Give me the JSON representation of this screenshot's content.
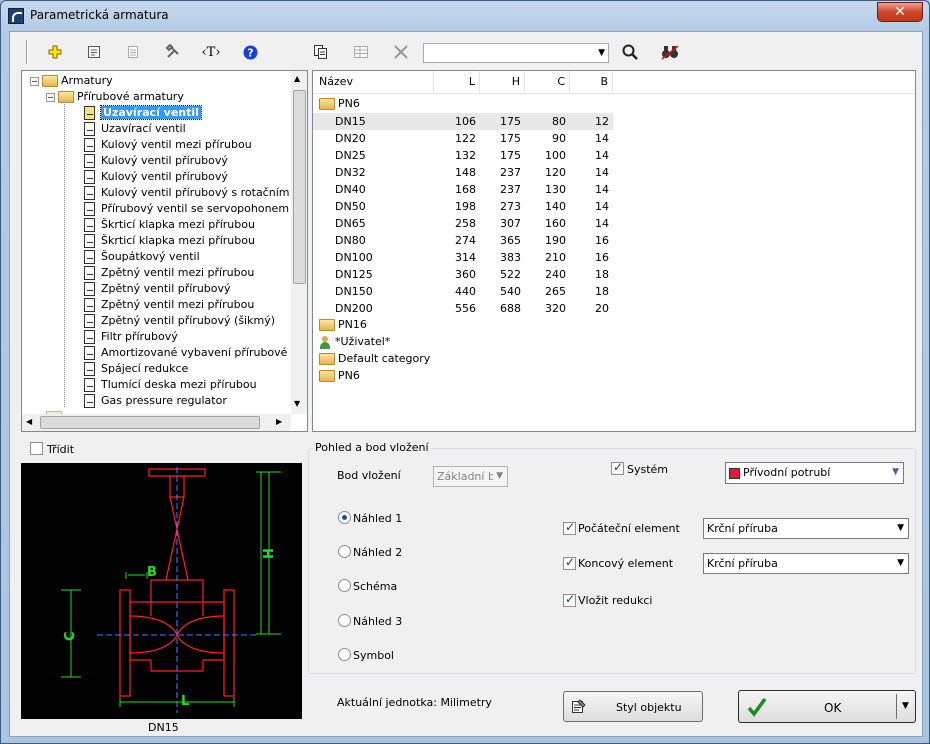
{
  "window": {
    "title": "Parametrická armatura"
  },
  "toolbar": {
    "icons": [
      "add-icon",
      "properties-icon",
      "list-icon",
      "tools-icon",
      "text-icon",
      "help-icon",
      "copy-icon",
      "table-icon",
      "delete-icon",
      "search-icon",
      "binoculars-icon"
    ],
    "search_value": ""
  },
  "tree": {
    "root": "Armatury",
    "group": "Přírubové armatury",
    "items": [
      "Uzavírací ventil",
      "Uzavírací ventil",
      "Kulový ventil mezi přírubou",
      "Kulový ventil přírubový",
      "Kulový ventil přírubový",
      "Kulový ventil přírubový s rotačním píste",
      "Přírubový ventil se servopohonem",
      "Škrticí klapka mezi přírubou",
      "Škrticí klapka mezi přírubou",
      "Šoupátkový ventil",
      "Zpětný ventil mezi přírubou",
      "Zpětný ventil přírubový",
      "Zpětný ventil mezi přírubou",
      "Zpětný ventil přírubový (šikmý)",
      "Filtr přírubový",
      "Amortizované vybavení přírubové",
      "Spájecí redukce",
      "Tlumící deska mezi přírubou",
      "Gas pressure regulator"
    ],
    "selected_index": 0
  },
  "table": {
    "columns": [
      "Název",
      "L",
      "H",
      "C",
      "B"
    ],
    "group1": "PN6",
    "rows": [
      [
        "DN15",
        "106",
        "175",
        "80",
        "12"
      ],
      [
        "DN20",
        "122",
        "175",
        "90",
        "14"
      ],
      [
        "DN25",
        "132",
        "175",
        "100",
        "14"
      ],
      [
        "DN32",
        "148",
        "237",
        "120",
        "14"
      ],
      [
        "DN40",
        "168",
        "237",
        "130",
        "14"
      ],
      [
        "DN50",
        "198",
        "273",
        "140",
        "14"
      ],
      [
        "DN65",
        "258",
        "307",
        "160",
        "14"
      ],
      [
        "DN80",
        "274",
        "365",
        "190",
        "16"
      ],
      [
        "DN100",
        "314",
        "383",
        "210",
        "16"
      ],
      [
        "DN125",
        "360",
        "522",
        "240",
        "18"
      ],
      [
        "DN150",
        "440",
        "540",
        "265",
        "18"
      ],
      [
        "DN200",
        "556",
        "688",
        "320",
        "20"
      ]
    ],
    "groups_after": [
      "PN16",
      "*Uživatel*",
      "Default category",
      "PN6"
    ]
  },
  "sort": {
    "label": "Třídit",
    "checked": false
  },
  "preview": {
    "caption": "DN15",
    "dims": {
      "B": "B",
      "H": "H",
      "C": "C",
      "L": "L"
    }
  },
  "view": {
    "title": "Pohled a bod vložení",
    "insert_point_label": "Bod vložení",
    "insert_point_value": "Základní bod",
    "radios": [
      "Náhled 1",
      "Náhled 2",
      "Schéma",
      "Náhled 3",
      "Symbol"
    ],
    "radio_selected": 0,
    "system_label": "Systém",
    "system_value": "Přívodní potrubí",
    "system_color": "#e0193a",
    "start_label": "Počáteční element",
    "start_value": "Krční příruba",
    "end_label": "Koncový element",
    "end_value": "Krční příruba",
    "reduce_label": "Vložit redukci"
  },
  "footer": {
    "units": "Aktuální jednotka: Milimetry",
    "style_button": "Styl objektu",
    "ok_button": "OK"
  }
}
